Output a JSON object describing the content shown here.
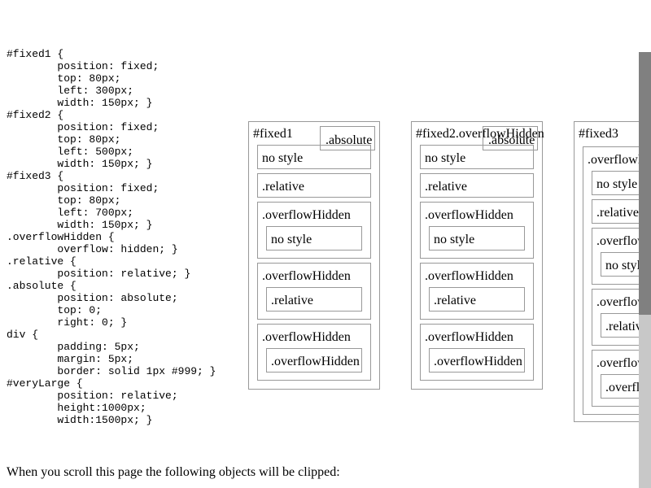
{
  "css_code": "#fixed1 {\n\tposition: fixed;\n\ttop: 80px;\n\tleft: 300px;\n\twidth: 150px; }\n#fixed2 {\n\tposition: fixed;\n\ttop: 80px;\n\tleft: 500px;\n\twidth: 150px; }\n#fixed3 {\n\tposition: fixed;\n\ttop: 80px;\n\tleft: 700px;\n\twidth: 150px; }\n.overflowHidden {\n\toverflow: hidden; }\n.relative {\n\tposition: relative; }\n.absolute {\n\tposition: absolute;\n\ttop: 0;\n\tright: 0; }\ndiv {\n\tpadding: 5px;\n\tmargin: 5px;\n\tborder: solid 1px #999; }\n#veryLarge {\n\tposition: relative;\n\theight:1000px;\n\twidth:1500px; }",
  "caption": "When you scroll this page the following objects will be clipped:",
  "fixed1": {
    "title": "#fixed1",
    "absolute_label": ".absolute",
    "no_style_label": "no style",
    "relative_label": ".relative",
    "section_labels": [
      ".overflowHidden",
      ".overflowHidden",
      ".overflowHidden"
    ],
    "inner_labels": [
      "no style",
      ".relative",
      ".overflowHidden"
    ]
  },
  "fixed2": {
    "title": "#fixed2.overflowHidden",
    "absolute_label": ".absolute",
    "no_style_label": "no style",
    "relative_label": ".relative",
    "section_labels": [
      ".overflowHidden",
      ".overflowHidden",
      ".overflowHidden"
    ],
    "inner_labels": [
      "no style",
      ".relative",
      ".overflowHidden"
    ]
  },
  "fixed3": {
    "title": "#fixed3",
    "outer_label": ".overflowHidden",
    "no_style_label": "no style",
    "relative_label": ".relative",
    "section_labels": [
      ".overflowHidden",
      ".overflowHidden",
      ".overflowHidden"
    ],
    "inner_labels": [
      "no style",
      ".relative",
      ".overflowHidden"
    ]
  },
  "colors": {
    "border": "#999999",
    "scrollbar_track": "#c8c8c8",
    "scrollbar_thumb": "#808080"
  }
}
